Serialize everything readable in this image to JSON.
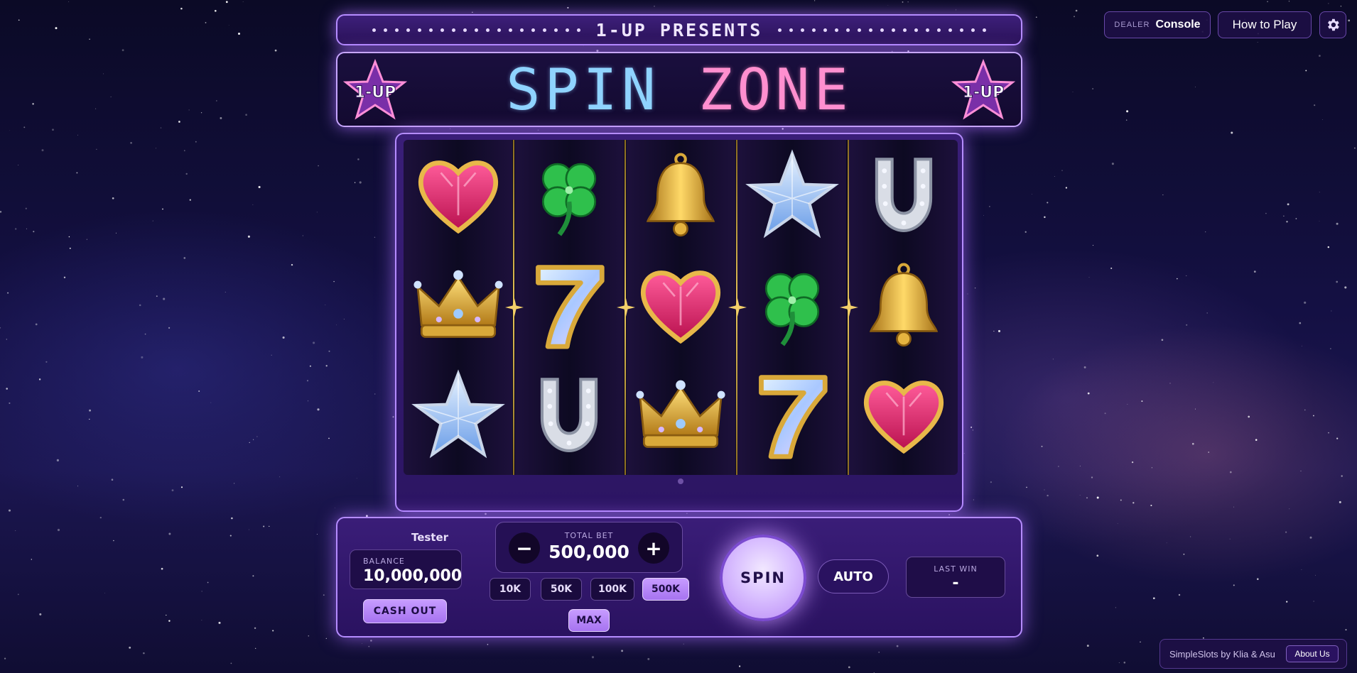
{
  "header": {
    "dealer_small": "DEALER",
    "dealer_label": "Console",
    "how_to_play": "How to Play",
    "settings_icon": "gear-icon"
  },
  "banner": {
    "presents": "1-UP PRESENTS",
    "title_word1": "SPIN",
    "title_word2": "ZONE",
    "logo_text": "1-UP"
  },
  "reels": {
    "grid": [
      [
        "heart",
        "clover",
        "bell",
        "star",
        "horseshoe"
      ],
      [
        "crown",
        "seven",
        "heart",
        "clover",
        "bell"
      ],
      [
        "star",
        "horseshoe",
        "crown",
        "seven",
        "heart"
      ]
    ]
  },
  "controls": {
    "player_name": "Tester",
    "balance_label": "BALANCE",
    "balance_value": "10,000,000",
    "cash_out": "CASH OUT",
    "total_bet_label": "TOTAL BET",
    "total_bet_value": "500,000",
    "minus": "−",
    "plus": "+",
    "chips": [
      "10K",
      "50K",
      "100K",
      "500K"
    ],
    "active_chip": "500K",
    "max": "MAX",
    "spin": "SPIN",
    "auto": "AUTO",
    "last_win_label": "LAST WIN",
    "last_win_value": "-"
  },
  "footer": {
    "credit": "SimpleSlots by Klia & Asu",
    "about": "About Us"
  },
  "colors": {
    "accent": "#b58cff",
    "title_blue": "#8fd3ff",
    "title_pink": "#ff8fcf",
    "gold": "#e8c45a"
  }
}
